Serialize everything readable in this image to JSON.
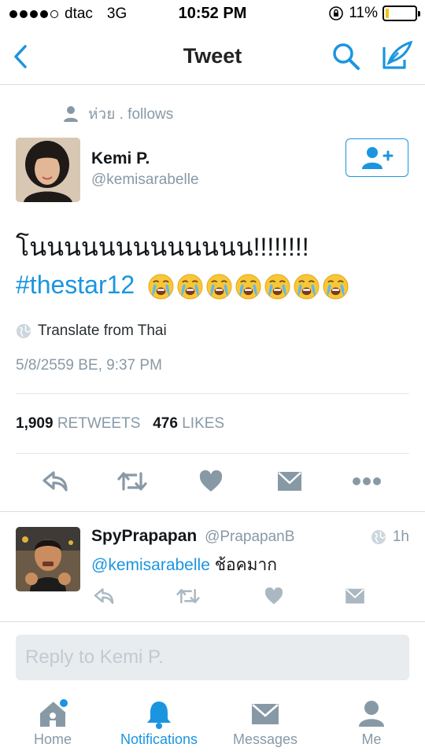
{
  "status_bar": {
    "carrier": "dtac",
    "network": "3G",
    "time": "10:52 PM",
    "battery": "11%",
    "battery_level": 0.11
  },
  "nav": {
    "title": "Tweet",
    "back_icon": "chevron-left-icon",
    "search_icon": "search-icon",
    "compose_icon": "compose-tweet-icon"
  },
  "context": {
    "text": "ห่วย . follows",
    "icon": "person-icon"
  },
  "tweet": {
    "author_name": "Kemi P.",
    "author_handle": "@kemisarabelle",
    "text": "โนนนนนนนนนนนนน!!!!!!!!",
    "hashtag": "#thestar12",
    "emoji": [
      "😭",
      "😭",
      "😭",
      "😭",
      "😭",
      "😭",
      "😭"
    ],
    "translate": "Translate from Thai",
    "timestamp": "5/8/2559 BE, 9:37 PM",
    "retweets_count": "1,909",
    "retweets_label": "RETWEETS",
    "likes_count": "476",
    "likes_label": "LIKES"
  },
  "reply": {
    "name": "SpyPrapapan",
    "handle": "@PrapapanB",
    "time": "1h",
    "mention": "@kemisarabelle",
    "text": "ช้อคมาก"
  },
  "composer": {
    "placeholder": "Reply to Kemi P."
  },
  "tabs": [
    {
      "label": "Home",
      "icon": "home-icon"
    },
    {
      "label": "Notifications",
      "icon": "bell-icon"
    },
    {
      "label": "Messages",
      "icon": "envelope-icon"
    },
    {
      "label": "Me",
      "icon": "person-icon"
    }
  ],
  "colors": {
    "accent": "#1b95e0",
    "muted": "#8899a6",
    "battery": "#f5c400"
  }
}
